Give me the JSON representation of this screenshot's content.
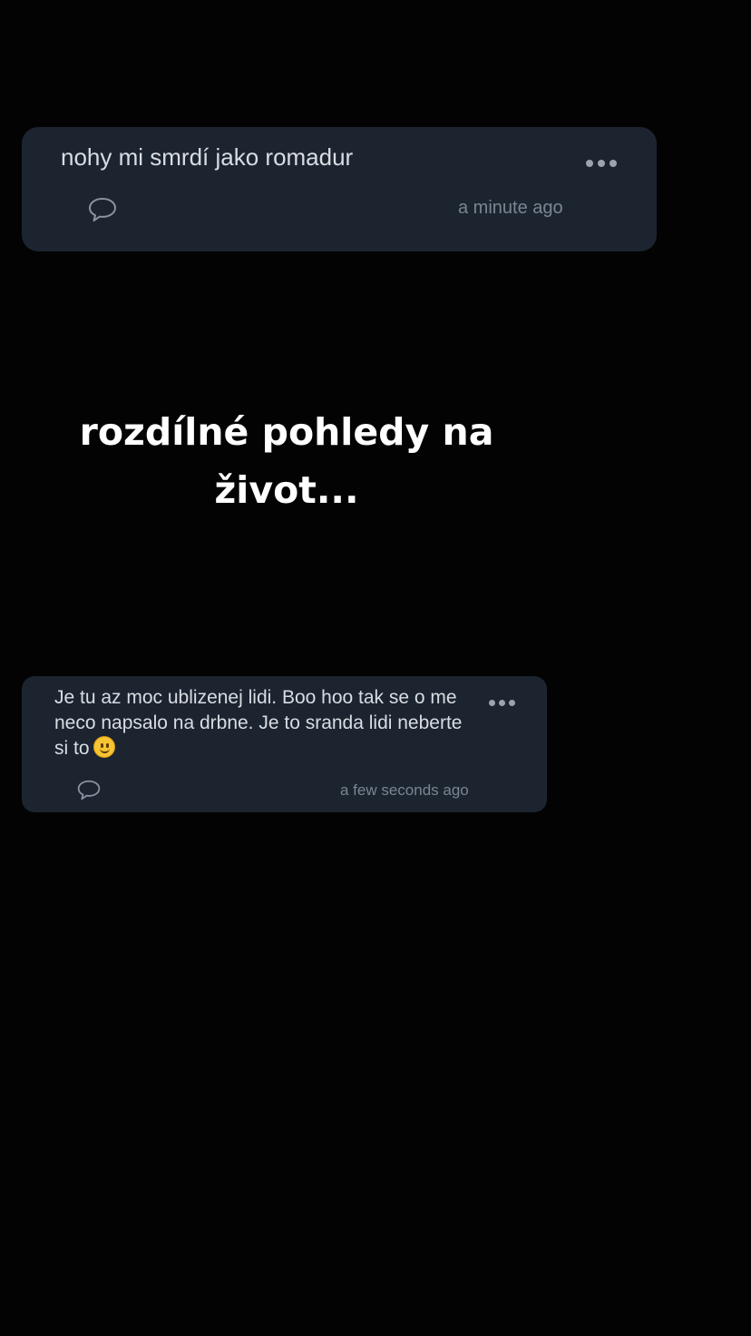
{
  "posts": [
    {
      "text": "nohy mi smrdí jako romadur",
      "time": "a minute ago",
      "icons": {
        "comment": "comment-icon",
        "more": "more-options-icon"
      }
    },
    {
      "text": "Je tu az moc ublizenej lidi. Boo hoo tak se o me neco napsalo na drbne. Je to sranda lidi neberte si to",
      "emoji": "slightly-smiling-face",
      "time": "a few seconds ago",
      "icons": {
        "comment": "comment-icon",
        "more": "more-options-icon"
      }
    }
  ],
  "caption": "rozdílné pohledy na život...",
  "colors": {
    "background": "#030303",
    "card": "#1c2430",
    "post_text": "#d9dde3",
    "meta_text": "#7b8592"
  }
}
